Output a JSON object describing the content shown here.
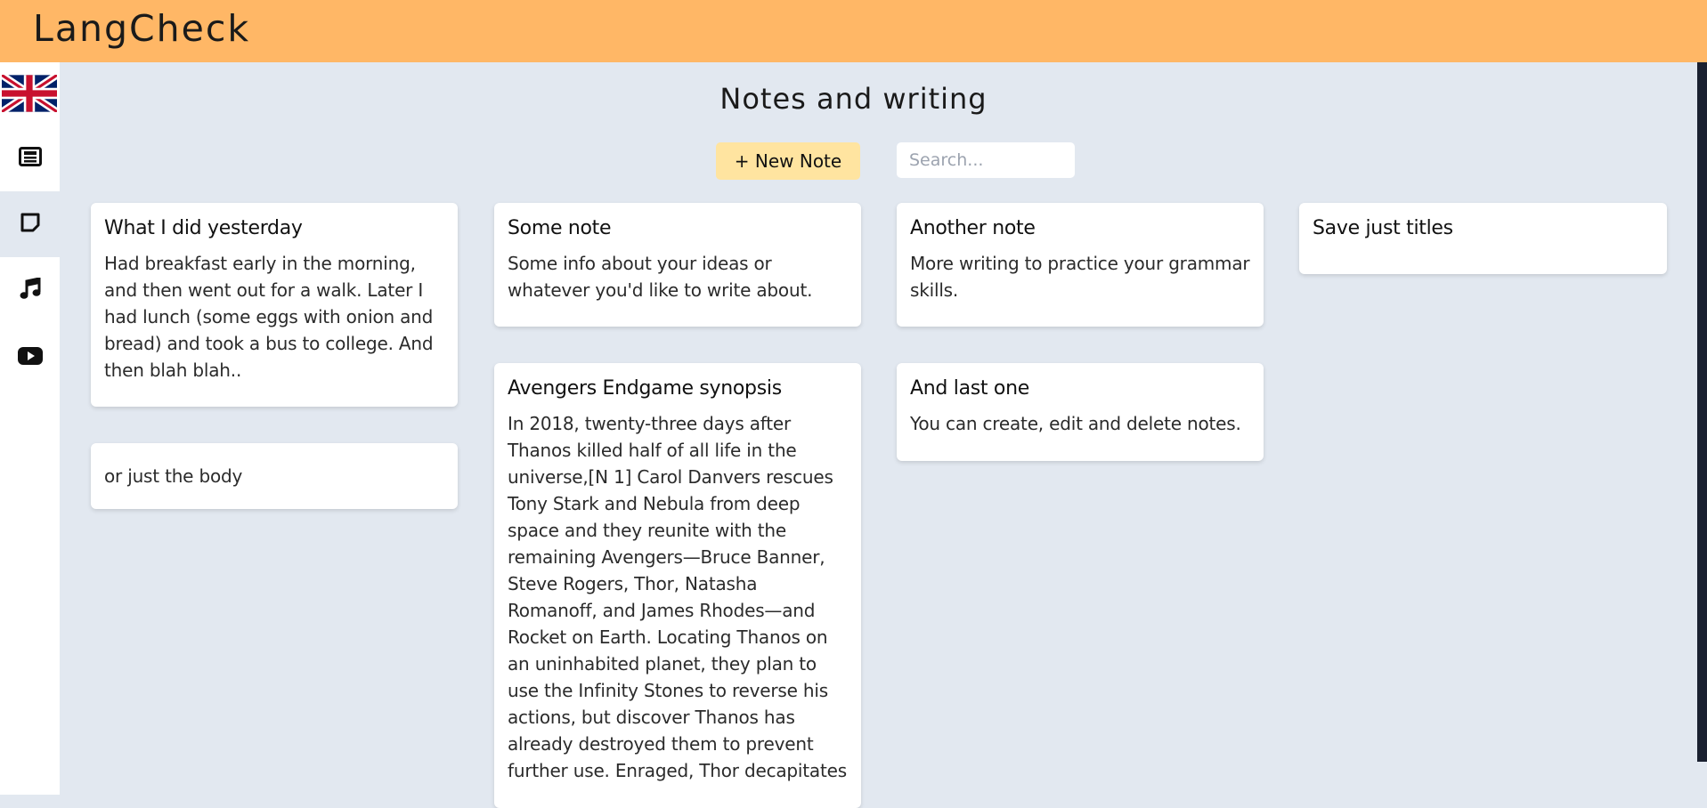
{
  "app": {
    "brand": "LangCheck"
  },
  "sidebar": {
    "items": [
      {
        "name": "language-flag",
        "icon": "uk-flag-icon"
      },
      {
        "name": "news",
        "icon": "newspaper-icon"
      },
      {
        "name": "notes",
        "icon": "note-icon",
        "active": true
      },
      {
        "name": "music",
        "icon": "music-note-icon"
      },
      {
        "name": "video",
        "icon": "youtube-icon"
      }
    ]
  },
  "page": {
    "title": "Notes and writing",
    "new_note_label": "+ New Note",
    "search_placeholder": "Search..."
  },
  "notes": [
    {
      "title": "What I did yesterday",
      "body": "Had breakfast early in the morning, and then went out for a walk. Later I had lunch (some eggs with onion and bread) and took a bus to college. And then blah blah.."
    },
    {
      "title": "",
      "body": "or just the body"
    },
    {
      "title": "Some note",
      "body": "Some info about your ideas or whatever you'd like to write about."
    },
    {
      "title": "Avengers Endgame synopsis",
      "body": "In 2018, twenty-three days after Thanos killed half of all life in the universe,[N 1] Carol Danvers rescues Tony Stark and Nebula from deep space and they reunite with the remaining Avengers—Bruce Banner, Steve Rogers, Thor, Natasha Romanoff, and James Rhodes—and Rocket on Earth. Locating Thanos on an uninhabited planet, they plan to use the Infinity Stones to reverse his actions, but discover Thanos has already destroyed them to prevent further use. Enraged, Thor decapitates"
    },
    {
      "title": "Another note",
      "body": "More writing to practice your grammar skills."
    },
    {
      "title": "And last one",
      "body": "You can create, edit and delete notes."
    },
    {
      "title": "Save just titles",
      "body": ""
    }
  ],
  "colors": {
    "topbar": "#ffb766",
    "background": "#e2e8f0",
    "new_note_button": "#ffe4a0"
  }
}
